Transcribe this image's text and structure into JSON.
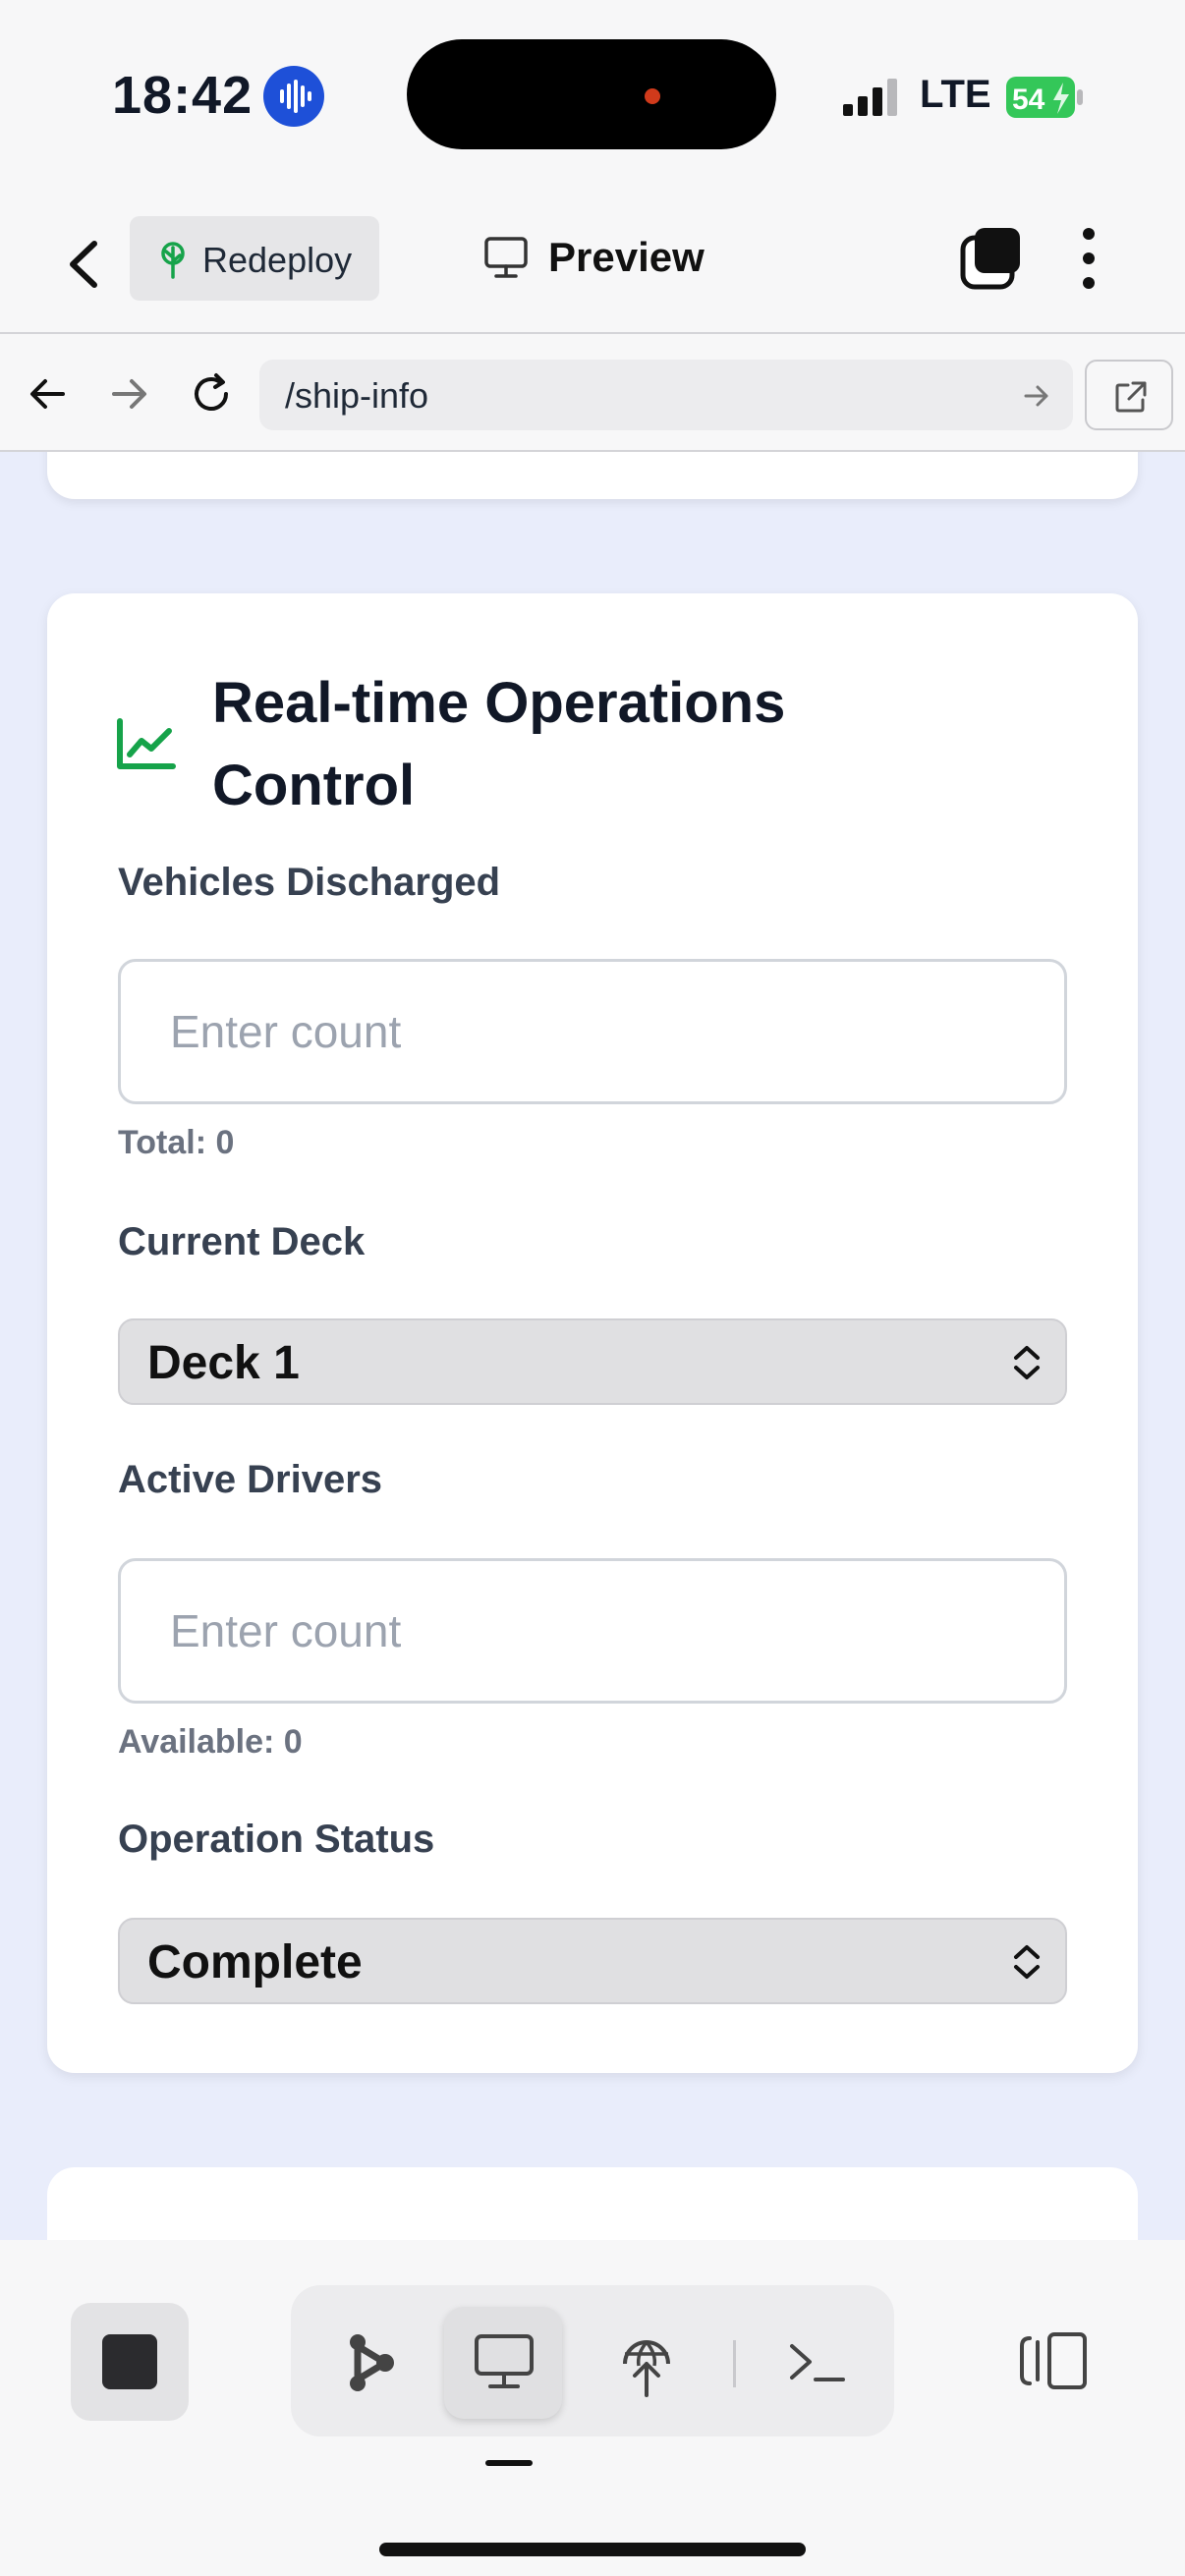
{
  "status_bar": {
    "time": "18:42",
    "network": "LTE",
    "battery": "54",
    "signal_bars": 3
  },
  "app_header": {
    "redeploy_label": "Redeploy",
    "preview_label": "Preview"
  },
  "browser": {
    "url": "/ship-info"
  },
  "card": {
    "title": "Real-time Operations Control",
    "icon": "chart-line-icon",
    "fields": {
      "vehicles": {
        "label": "Vehicles Discharged",
        "placeholder": "Enter count",
        "value": "",
        "helper": "Total: 0"
      },
      "deck": {
        "label": "Current Deck",
        "selected": "Deck 1"
      },
      "drivers": {
        "label": "Active Drivers",
        "placeholder": "Enter count",
        "value": "",
        "helper": "Available: 0"
      },
      "status": {
        "label": "Operation Status",
        "selected": "Complete"
      }
    }
  },
  "toolbar": {
    "active_tab": "preview"
  },
  "colors": {
    "accent_green": "#16a34a",
    "content_bg": "#e9edfb",
    "siri_blue": "#1e50d8",
    "battery_green": "#34c759"
  }
}
